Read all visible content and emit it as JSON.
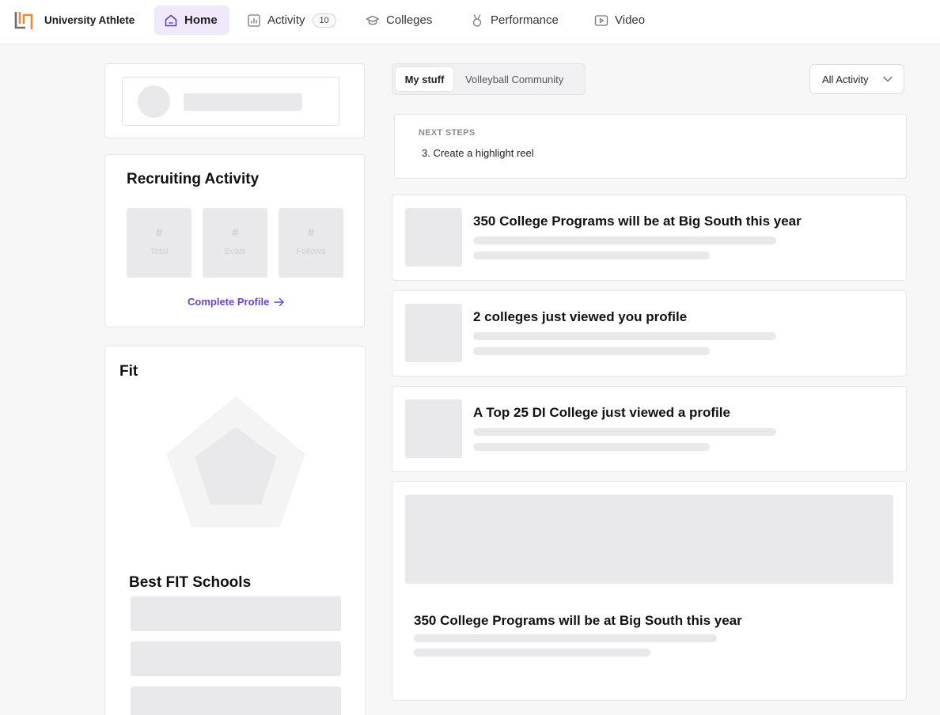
{
  "brand": {
    "name": "University Athlete",
    "logo_icon": "university-athlete-logo"
  },
  "nav": {
    "items": [
      {
        "label": "Home",
        "icon": "home-icon",
        "active": true
      },
      {
        "label": "Activity",
        "icon": "bar-chart-icon",
        "badge": "10"
      },
      {
        "label": "Colleges",
        "icon": "graduation-cap-icon"
      },
      {
        "label": "Performance",
        "icon": "medal-icon"
      },
      {
        "label": "Video",
        "icon": "video-play-icon"
      }
    ]
  },
  "recruiting": {
    "title": "Recruiting Activity",
    "stats": [
      {
        "value": "#",
        "label": "Total"
      },
      {
        "value": "#",
        "label": "Evals"
      },
      {
        "value": "#",
        "label": "Follows"
      }
    ],
    "complete_link": "Complete Profile"
  },
  "fit": {
    "title": "Fit",
    "schools_title": "Best FIT Schools"
  },
  "feed": {
    "tabs": [
      "My stuff",
      "Volleyball Community"
    ],
    "filter": "All Activity",
    "next_steps": {
      "label": "NEXT STEPS",
      "item": "3. Create a highlight reel"
    },
    "items": [
      {
        "title": "350 College Programs will be at Big South this year"
      },
      {
        "title": "2 colleges just viewed you profile"
      },
      {
        "title": "A Top 25 DI College just viewed a profile"
      }
    ],
    "featured": {
      "title": "350 College Programs will be at Big South this year"
    }
  },
  "colors": {
    "accent": "#6a45c2",
    "active_nav_bg": "#efe9fb",
    "logo_orange": "#e8893c",
    "logo_gray": "#6b6b70"
  }
}
